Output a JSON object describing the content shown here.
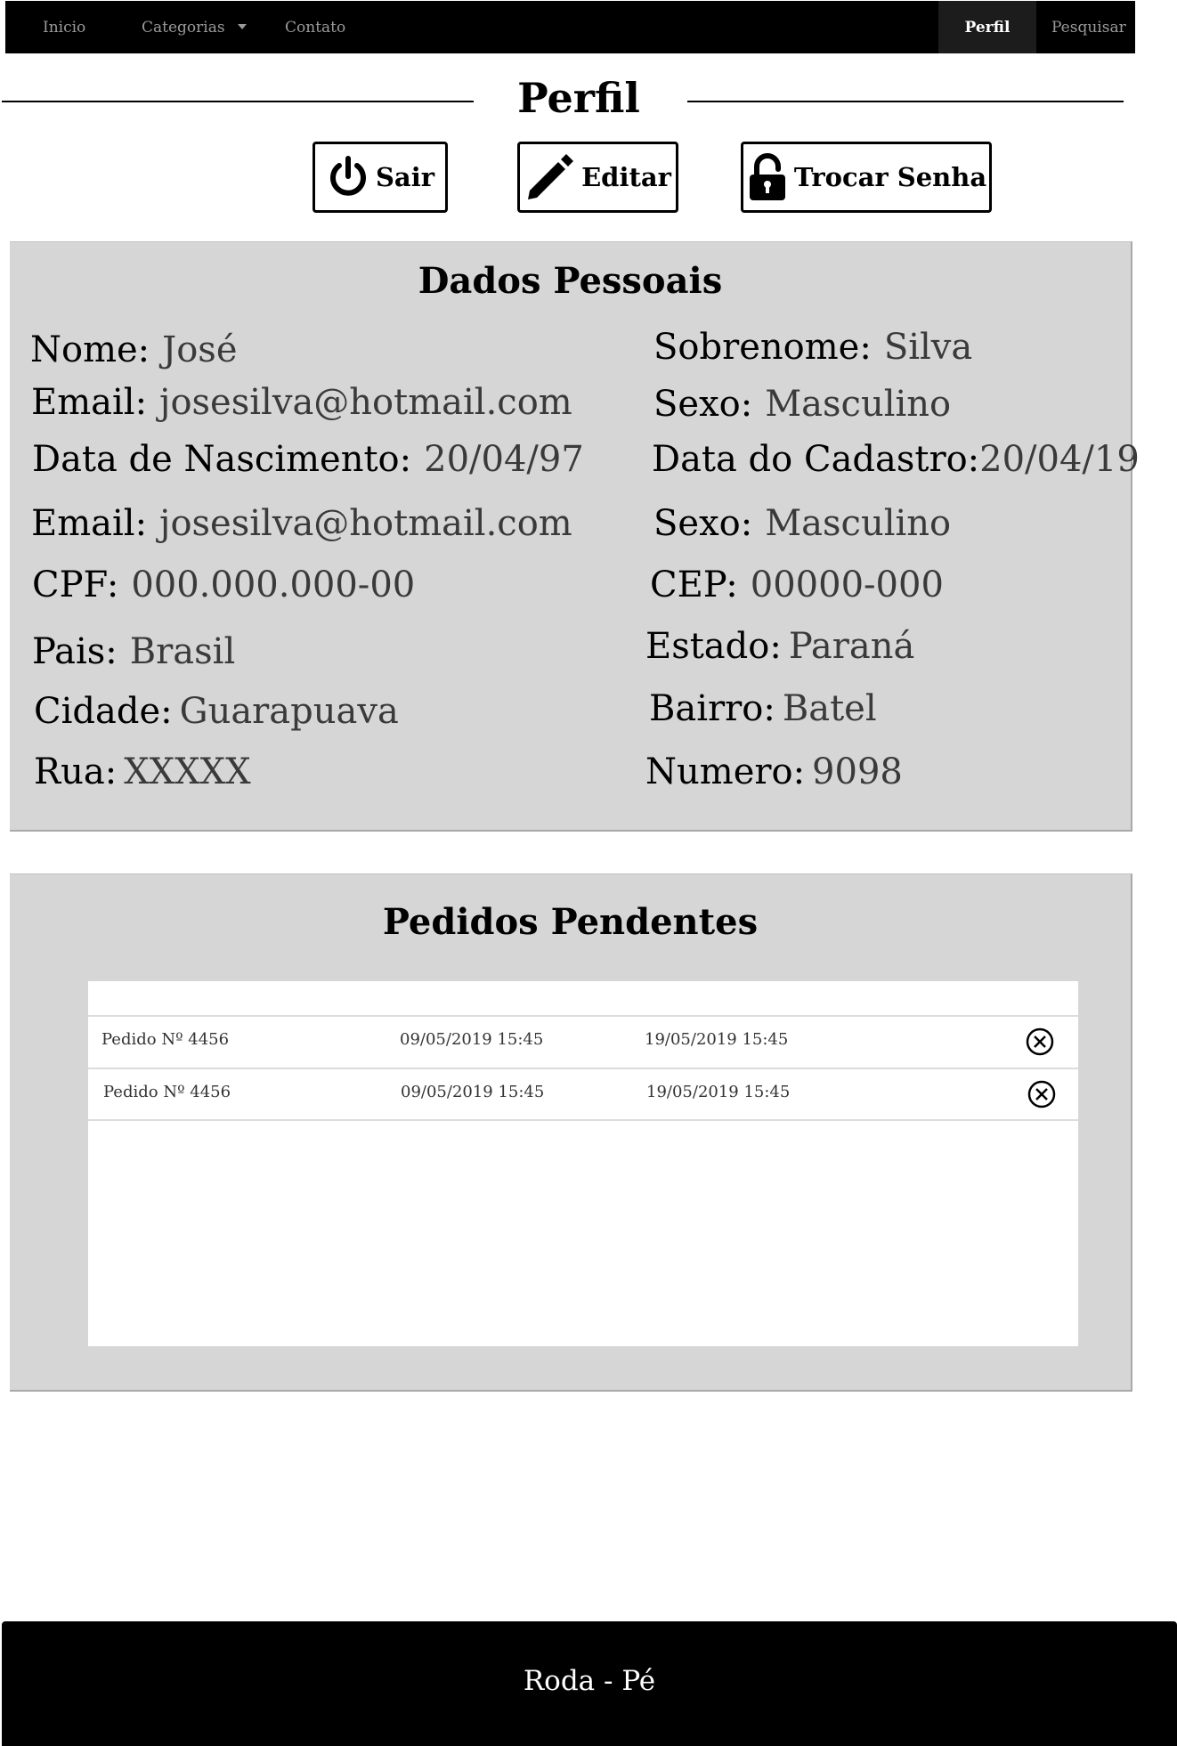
{
  "nav": {
    "home": "Inicio",
    "categories": "Categorias",
    "contact": "Contato",
    "profile": "Perfil",
    "search": "Pesquisar"
  },
  "page_title": "Perfil",
  "actions": {
    "logout": "Sair",
    "edit": "Editar",
    "change_password": "Trocar Senha"
  },
  "personal": {
    "title": "Dados Pessoais",
    "left": [
      {
        "label": "Nome:",
        "value": "José"
      },
      {
        "label": "Email:",
        "value": "josesilva@hotmail.com"
      },
      {
        "label": "Data de Nascimento:",
        "value": "20/04/97"
      },
      {
        "label": "Email:",
        "value": "josesilva@hotmail.com"
      },
      {
        "label": "CPF:",
        "value": "000.000.000-00"
      },
      {
        "label": "Pais:",
        "value": "Brasil"
      },
      {
        "label": "Cidade:",
        "value": "Guarapuava"
      },
      {
        "label": "Rua:",
        "value": "XXXXX"
      }
    ],
    "right": [
      {
        "label": "Sobrenome:",
        "value": "Silva"
      },
      {
        "label": "Sexo:",
        "value": "Masculino"
      },
      {
        "label": "Data do Cadastro:",
        "value": "20/04/19"
      },
      {
        "label": "Sexo:",
        "value": "Masculino"
      },
      {
        "label": "CEP:",
        "value": "00000-000"
      },
      {
        "label": "Estado:",
        "value": "Paraná"
      },
      {
        "label": "Bairro:",
        "value": "Batel"
      },
      {
        "label": "Numero:",
        "value": "9098"
      }
    ]
  },
  "orders": {
    "title": "Pedidos Pendentes",
    "rows": [
      {
        "order": "Pedido Nº 4456",
        "date": "09/05/2019 15:45",
        "due": "19/05/2019 15:45"
      },
      {
        "order": "Pedido Nº 4456",
        "date": "09/05/2019 15:45",
        "due": "19/05/2019 15:45"
      }
    ]
  },
  "footer": "Roda - Pé"
}
